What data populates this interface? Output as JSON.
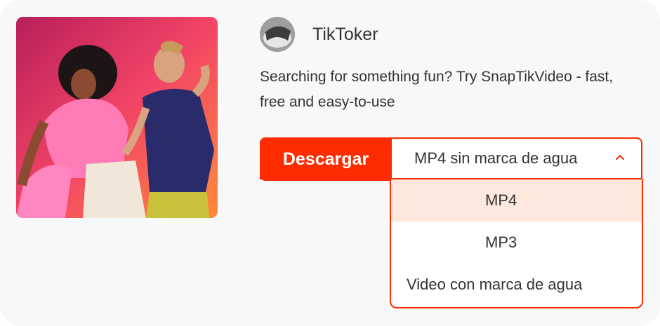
{
  "video": {
    "author": "TikToker",
    "description": "Searching for something fun? Try SnapTikVideo - fast, free and easy-to-use"
  },
  "download": {
    "button_label": "Descargar",
    "selected_format": "MP4 sin marca de agua",
    "options": [
      "MP4",
      "MP3",
      "Video con marca de agua"
    ],
    "highlighted_option": "MP4"
  },
  "colors": {
    "accent": "#fe2c00",
    "option_highlight": "#fde8dd",
    "text": "#333333",
    "card_background": "#f7f8fa"
  },
  "icons": {
    "dropdown_toggle": "chevron-up-icon"
  }
}
